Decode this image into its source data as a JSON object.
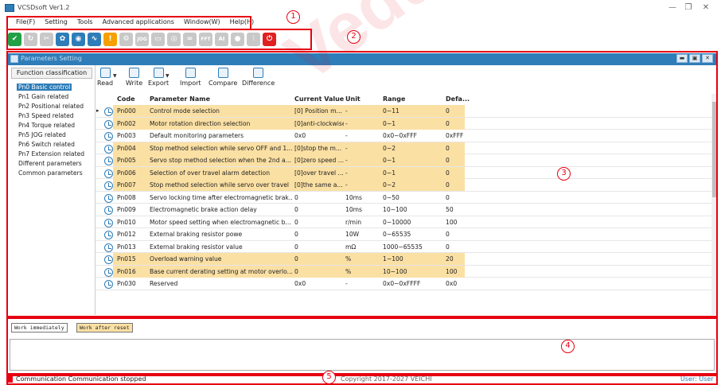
{
  "window": {
    "title": "VCSDsoft Ver1.2",
    "minimize": "—",
    "maximize": "❐",
    "close": "✕"
  },
  "menu": [
    "File(F)",
    "Setting",
    "Tools",
    "Advanced applications",
    "Window(W)",
    "Help(H)"
  ],
  "toolbar_icons": [
    "check-icon",
    "refresh-icon",
    "tools-icon",
    "gear-icon",
    "eye-icon",
    "waveform-icon",
    "warning-icon",
    "gear-cog-icon",
    "jog-icon",
    "monitor-icon",
    "target-icon",
    "link-icon",
    "fft-icon",
    "ai-icon",
    "bulb-icon",
    "sliders-icon",
    "power-icon"
  ],
  "toolbar_labels": {
    "jog": "JOG",
    "fft": "FFT",
    "ai": "AI"
  },
  "annotations": [
    "1",
    "2",
    "3",
    "4",
    "5"
  ],
  "panel": {
    "title": "Parameters Setting"
  },
  "sidebar": {
    "function_classification": "Function classification",
    "items": [
      "Pn0 Basic control",
      "Pn1 Gain related",
      "Pn2 Positional related",
      "Pn3 Speed related",
      "Pn4 Torque related",
      "Pn5 JOG related",
      "Pn6 Switch related",
      "Pn7 Extension related",
      "Different parameters",
      "Common parameters"
    ],
    "selected_index": 0
  },
  "ribbon": {
    "read": "Read",
    "write": "Write",
    "export": "Export",
    "import": "Import",
    "compare": "Compare",
    "difference": "Difference"
  },
  "table": {
    "columns": [
      "Code",
      "Parameter Name",
      "Current Value",
      "Unit",
      "Range",
      "Defa..."
    ],
    "rows": [
      {
        "code": "Pn000",
        "name": "Control mode selection",
        "value": "[0] Position m...",
        "unit": "-",
        "range": "0~11",
        "default": "0",
        "hl": true,
        "current": true
      },
      {
        "code": "Pn002",
        "name": "Motor rotation direction selection",
        "value": "[0]anti-clockwise",
        "unit": "-",
        "range": "0~1",
        "default": "0",
        "hl": true
      },
      {
        "code": "Pn003",
        "name": "Default monitoring parameters",
        "value": "0x0",
        "unit": "-",
        "range": "0x0~0xFFF",
        "default": "0xFFF",
        "hl": false
      },
      {
        "code": "Pn004",
        "name": "Stop method selection while servo OFF and 1...",
        "value": "[0]stop the m...",
        "unit": "-",
        "range": "0~2",
        "default": "0",
        "hl": true
      },
      {
        "code": "Pn005",
        "name": "Servo stop method selection when the 2nd a...",
        "value": "[0]zero speed ...",
        "unit": "-",
        "range": "0~1",
        "default": "0",
        "hl": true
      },
      {
        "code": "Pn006",
        "name": "Selection of over travel alarm detection",
        "value": "[0]over travel ...",
        "unit": "-",
        "range": "0~1",
        "default": "0",
        "hl": true
      },
      {
        "code": "Pn007",
        "name": "Stop method selection while servo over travel",
        "value": "[0]the same a...",
        "unit": "-",
        "range": "0~2",
        "default": "0",
        "hl": true
      },
      {
        "code": "Pn008",
        "name": "Servo locking time after electromagnetic brak...",
        "value": "0",
        "unit": "10ms",
        "range": "0~50",
        "default": "0",
        "hl": false
      },
      {
        "code": "Pn009",
        "name": "Electromagnetic brake action delay",
        "value": "0",
        "unit": "10ms",
        "range": "10~100",
        "default": "50",
        "hl": false
      },
      {
        "code": "Pn010",
        "name": "Motor speed setting when electromagnetic b...",
        "value": "0",
        "unit": "r/min",
        "range": "0~10000",
        "default": "100",
        "hl": false
      },
      {
        "code": "Pn012",
        "name": "External braking resistor powe",
        "value": "0",
        "unit": "10W",
        "range": "0~65535",
        "default": "0",
        "hl": false
      },
      {
        "code": "Pn013",
        "name": "External braking resistor value",
        "value": "0",
        "unit": "mΩ",
        "range": "1000~65535",
        "default": "0",
        "hl": false
      },
      {
        "code": "Pn015",
        "name": "Overload warning value",
        "value": "0",
        "unit": "%",
        "range": "1~100",
        "default": "20",
        "hl": true
      },
      {
        "code": "Pn016",
        "name": "Base current derating setting at motor overlo...",
        "value": "0",
        "unit": "%",
        "range": "10~100",
        "default": "100",
        "hl": true
      },
      {
        "code": "Pn030",
        "name": "Reserved",
        "value": "0x0",
        "unit": "-",
        "range": "0x0~0xFFFF",
        "default": "0x0",
        "hl": false
      }
    ]
  },
  "legend": {
    "immediately": "Work immediately",
    "after_reset": "Work after reset"
  },
  "status": {
    "communication": "Communication  Communication stopped",
    "copyright": "Copyright 2017-2027 VEICHI",
    "user": "User: User"
  },
  "watermark": "Vedusrive",
  "colors": {
    "accent": "#2e7db8",
    "highlight_row": "#fbe0a4",
    "annotation": "#e60012",
    "toolbar_orange": "#f5a000",
    "toolbar_green": "#22a045",
    "toolbar_red": "#e02020"
  }
}
